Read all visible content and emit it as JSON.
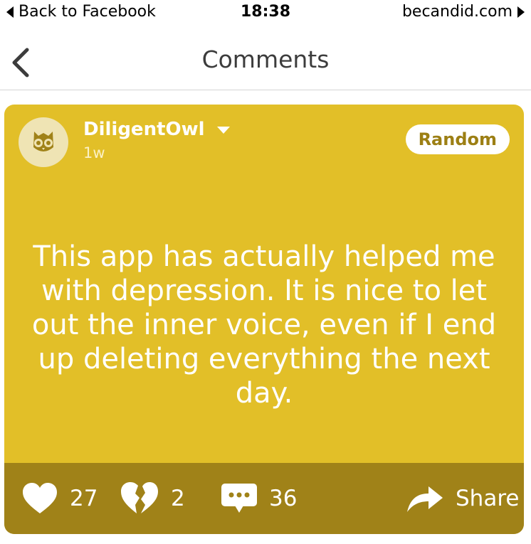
{
  "status_bar": {
    "back_label": "Back to Facebook",
    "time": "18:38",
    "url": "becandid.com"
  },
  "nav": {
    "title": "Comments"
  },
  "post": {
    "username": "DiligentOwl",
    "timestamp": "1w",
    "tag": "Random",
    "text": "This app has actually helped me with depression. It is nice to let out the inner voice, even if I end up deleting everything the next day.",
    "avatar_icon": "owl-icon",
    "accent_color": "#e2bf28",
    "footer_color": "#a08218"
  },
  "actions": {
    "likes": "27",
    "dislikes": "2",
    "comments": "36",
    "share_label": "Share"
  }
}
